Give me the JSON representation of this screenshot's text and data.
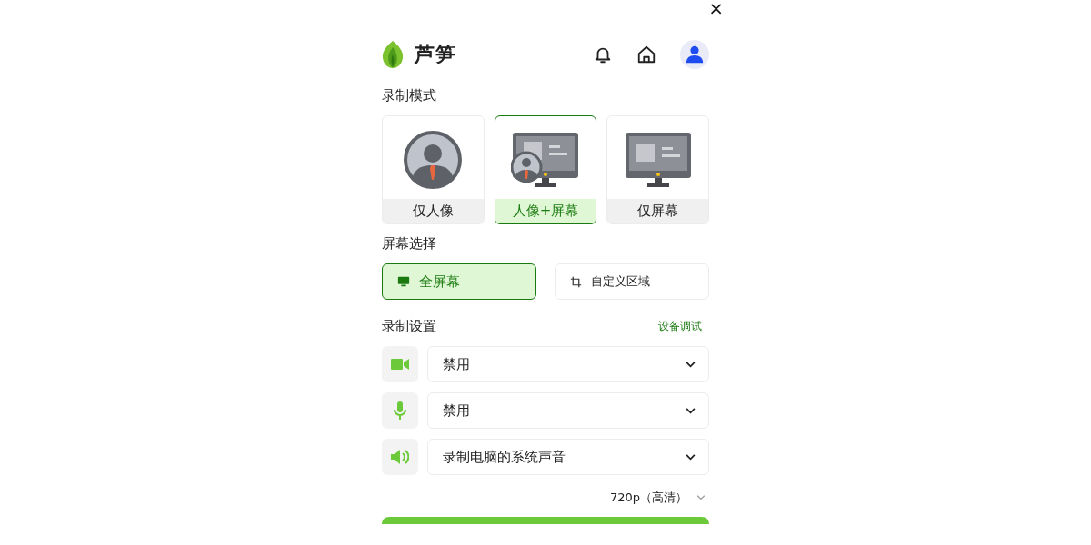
{
  "close": "×",
  "app": {
    "name": "芦笋"
  },
  "mode_section": {
    "title": "录制模式",
    "options": [
      {
        "kind": "portrait",
        "label": "仅人像",
        "selected": false
      },
      {
        "kind": "both",
        "label": "人像+屏幕",
        "selected": true
      },
      {
        "kind": "screen",
        "label": "仅屏幕",
        "selected": false
      }
    ]
  },
  "screen_section": {
    "title": "屏幕选择",
    "options": [
      {
        "kind": "fullscreen",
        "label": "全屏幕",
        "selected": true
      },
      {
        "kind": "region",
        "label": "自定义区域",
        "selected": false
      }
    ]
  },
  "settings": {
    "title": "录制设置",
    "link": "设备调试",
    "devices": [
      {
        "kind": "camera",
        "value": "禁用"
      },
      {
        "kind": "microphone",
        "value": "禁用"
      },
      {
        "kind": "speaker",
        "value": "录制电脑的系统声音"
      }
    ],
    "resolution": "720p（高清）"
  }
}
